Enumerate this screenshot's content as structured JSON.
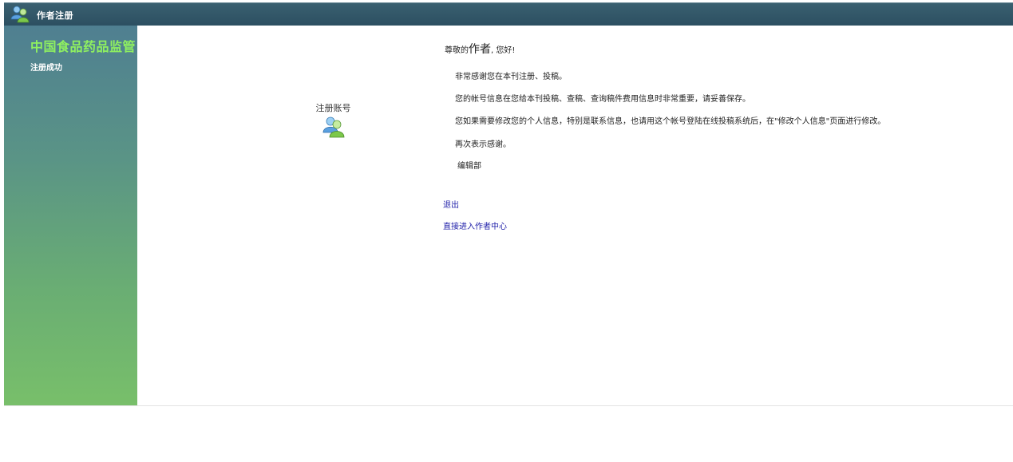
{
  "titlebar": {
    "title": "作者注册",
    "icon": "users-icon"
  },
  "sidebar": {
    "brand": "中国食品药品监管",
    "subtitle": "注册成功"
  },
  "account": {
    "label": "注册账号",
    "icon": "users-icon"
  },
  "message": {
    "greeting_prefix": "尊敬的",
    "greeting_name": "作者",
    "greeting_suffix": ", 您好!",
    "paragraphs": [
      "非常感谢您在本刊注册、投稿。",
      "您的帐号信息在您给本刊投稿、查稿、查询稿件费用信息时非常重要，请妥善保存。",
      "您如果需要修改您的个人信息，特别是联系信息，也请用这个帐号登陆在线投稿系统后，在\"修改个人信息\"页面进行修改。",
      "再次表示感谢。"
    ],
    "signature": "编辑部"
  },
  "links": {
    "logout": "退出",
    "author_center": "直接进入作者中心"
  },
  "colors": {
    "titlebar": "#2c4f61",
    "brand_text": "#8ff060",
    "link": "#2222aa",
    "sidebar_top": "#4f7f91",
    "sidebar_bottom": "#78bf6a"
  }
}
